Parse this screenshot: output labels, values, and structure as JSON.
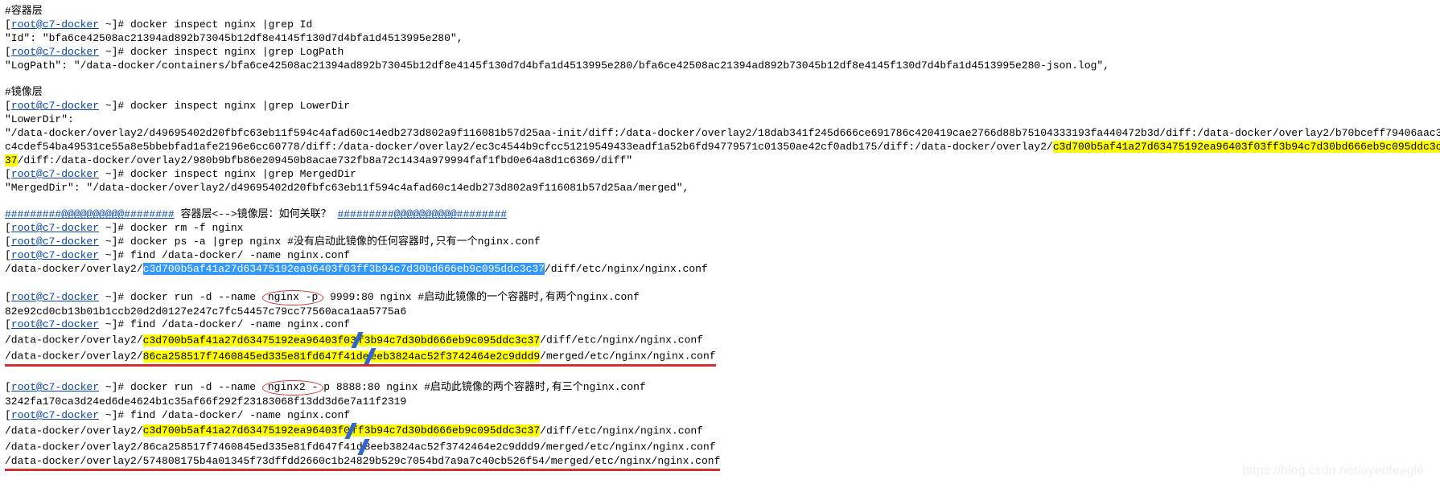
{
  "s1": {
    "header": "#容器层",
    "prompt": "root@c7-docker",
    "cmd1": " ~]# docker inspect nginx |grep Id",
    "out1": "        \"Id\": \"bfa6ce42508ac21394ad892b73045b12df8e4145f130d7d4bfa1d4513995e280\",",
    "cmd2": " ~]# docker inspect nginx |grep LogPath",
    "out2": "        \"LogPath\": \"/data-docker/containers/bfa6ce42508ac21394ad892b73045b12df8e4145f130d7d4bfa1d4513995e280/bfa6ce42508ac21394ad892b73045b12df8e4145f130d7d4bfa1d4513995e280-json.log\","
  },
  "s2": {
    "header": "#镜像层",
    "cmd1": " ~]# docker inspect nginx |grep LowerDir",
    "out1a": "            \"LowerDir\":",
    "out1b_pre": "\"/data-docker/overlay2/d49695402d20fbfc63eb11f594c4afad60c14edb273d802a9f116081b57d25aa-init/diff:/data-docker/overlay2/18dab341f245d666ce691786c420419cae2766d88b75104333193fa440472b3d/diff:/data-docker/overlay2/b70bceff79406aac3c4cdef54ba49531ce55a8e5bbebfad1afe2196e6cc60778/diff:/data-docker/overlay2/ec3c4544b9cfcc51219549433eadf1a52b6fd94779571c01350ae42cf0adb175/diff:/data-docker/overlay2/",
    "out1b_hl": "c3d700b5af41a27d63475192ea96403f03ff3b94c7d30bd666eb9c095ddc3c37",
    "out1b_post": "/diff:/data-docker/overlay2/980b9bfb86e209450b8acae732fb8a72c1434a979994faf1fbd0e64a8d1c6369/diff\"",
    "cmd2": " ~]# docker inspect nginx |grep MergedDir",
    "out2": "            \"MergedDir\": \"/data-docker/overlay2/d49695402d20fbfc63eb11f594c4afad60c14edb273d802a9f116081b57d25aa/merged\","
  },
  "div": {
    "a": "#########@@@@@@@@@@########",
    "txt": " 容器层<-->镜像层：如何关联？  ",
    "b": "#########@@@@@@@@@@########"
  },
  "s3": {
    "cmd1": " ~]# docker rm -f nginx",
    "cmd2": " ~]# docker ps -a |grep nginx   #没有启动此镜像的任何容器时,只有一个nginx.conf",
    "cmd3": " ~]# find /data-docker/ -name nginx.conf",
    "out_pre": "/data-docker/overlay2/",
    "out_hl": "c3d700b5af41a27d63475192ea96403f03ff3b94c7d30bd666eb9c095ddc3c37",
    "out_post": "/diff/etc/nginx/nginx.conf"
  },
  "s4": {
    "cmd1a": " ~]# docker run -d --name ",
    "circle1": "nginx -p",
    "cmd1b": " 9999:80 nginx   #启动此镜像的一个容器时,有两个nginx.conf",
    "out1": "82e92cd0cb13b01b1ccb20d2d0127e247c7fc54457c79cc77560aca1aa5775a6",
    "cmd2": " ~]# find /data-docker/ -name nginx.conf",
    "l1_pre": "/data-docker/overlay2/",
    "l1_hl_a": "c3d700b5af41a27d63475192ea96403f03",
    "l1_hl_b": "f3b94c7d30bd666eb9c095ddc3c37",
    "l1_post": "/diff/etc/nginx/nginx.conf",
    "l2_pre": "/data-docker/overlay2/",
    "l2_hl_a": "86ca258517f7460845ed335e81fd647f41de",
    "l2_hl_b": "eeb3824ac52f3742464e2c9ddd9",
    "l2_post": "/merged/etc/nginx/nginx.conf"
  },
  "s5": {
    "cmd1a": " ~]# docker run -d --name ",
    "circle1": "nginx2 -",
    "cmd1b": "p 8888:80 nginx #启动此镜像的两个容器时,有三个nginx.conf",
    "out1": "3242fa170ca3d24ed6de4624b1c35af66f292f23183068f13dd3d6e7a11f2319",
    "cmd2": " ~]# find /data-docker/ -name nginx.conf",
    "l1_pre": "/data-docker/overlay2/",
    "l1_hl_a": "c3d700b5af41a27d63475192ea96403f0",
    "l1_hl_b": "ff3b94c7d30bd666eb9c095ddc3c37",
    "l1_post": "/diff/etc/nginx/nginx.conf",
    "l2_pre": "/data-docker/overlay2/",
    "l2_hl_a": "86ca258517f7460845ed335e81fd647f41d",
    "l2_hl_b": "8eeb3824ac52f3742464e2c9ddd9",
    "l2_post": "/merged/etc/nginx/nginx.conf",
    "l3_pre": "/data-docker/overlay2/",
    "l3_hl_a": "574808175b4a01345f73dffdd2660c1b24829b5",
    "l3_hl_b": "29c7054bd7a9a7c40cb526f54",
    "l3_post": "/merged/etc/nginx/nginx.conf"
  },
  "watermark": "https://blog.csdn.net/eyeofeagle",
  "lbracket": "[",
  "rbracket": ""
}
